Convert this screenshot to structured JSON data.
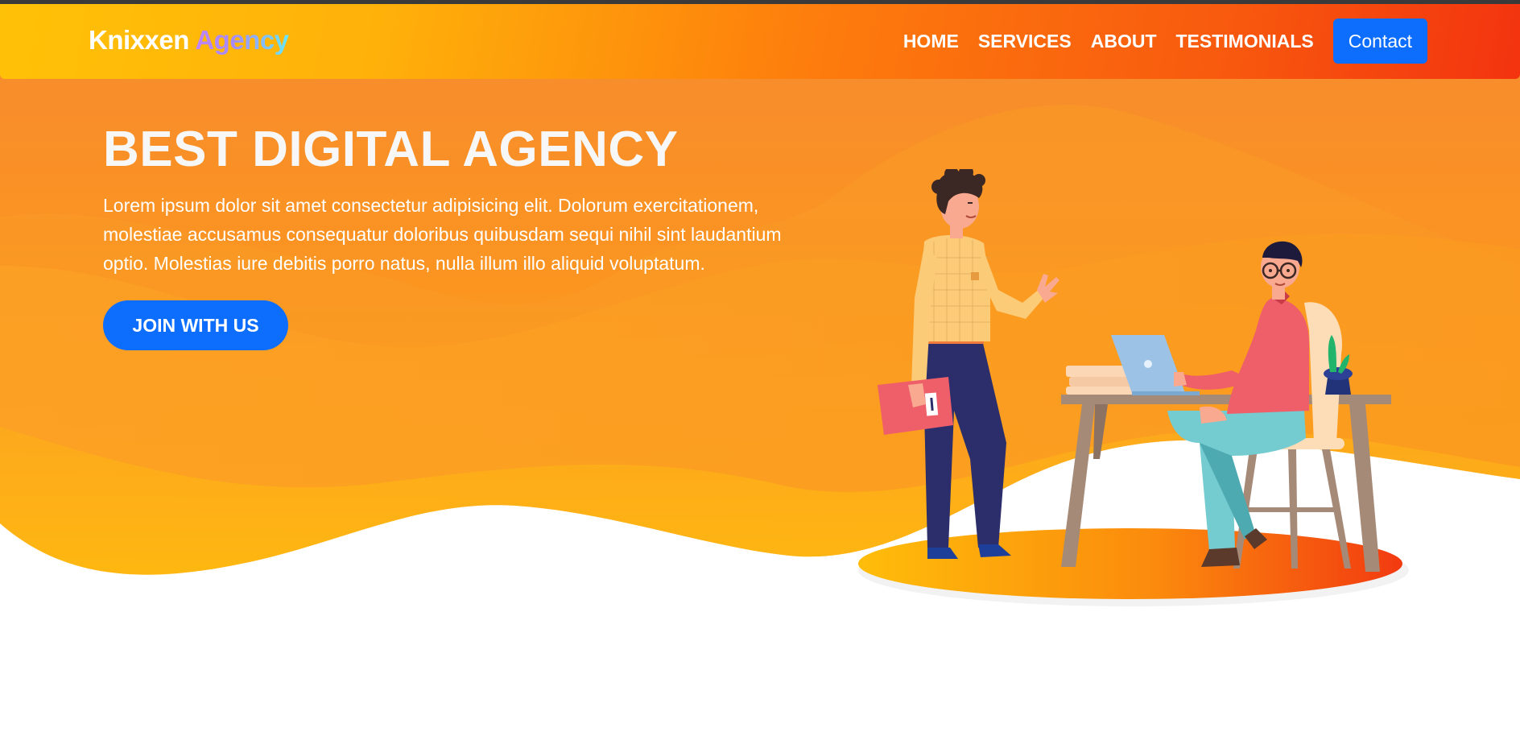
{
  "navbar": {
    "brand_main": "Knixxen",
    "brand_accent": "Agency",
    "links": [
      "HOME",
      "SERVICES",
      "ABOUT",
      "TESTIMONIALS"
    ],
    "contact_label": "Contact"
  },
  "hero": {
    "title": "BEST DIGITAL AGENCY",
    "text": "Lorem ipsum dolor sit amet consectetur adipisicing elit. Dolorum exercitationem, molestiae accusamus consequatur doloribus quibusdam sequi nihil sint laudantium optio. Molestias iure debitis porro natus, nulla illum illo aliquid voluptatum.",
    "cta_label": "JOIN WITH US"
  },
  "colors": {
    "gradient_start": "#ffc107",
    "gradient_end": "#f3330f",
    "button_blue": "#0d6efd",
    "hero_orange": "#f98a28"
  },
  "illustration": {
    "icons": [
      "standing-man-icon",
      "seated-man-icon",
      "desk-icon",
      "laptop-icon",
      "chair-icon",
      "plant-icon",
      "book-stack-icon",
      "folder-icon"
    ]
  }
}
